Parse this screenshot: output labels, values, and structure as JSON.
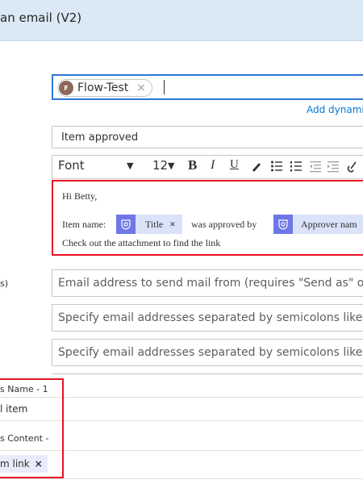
{
  "header": {
    "title": "an email (V2)"
  },
  "to": {
    "chip_label": "Flow-Test",
    "avatar_initial": "F",
    "chip_remove": "×",
    "add_dynamic": "Add dynami"
  },
  "subject": {
    "value": "Item approved"
  },
  "toolbar": {
    "font": "Font",
    "font_caret": "▼",
    "size": "12",
    "size_caret": "▼",
    "bold": "B",
    "italic": "I",
    "underline": "U"
  },
  "body": {
    "greeting": "Hi Betty,",
    "item_name_label": "Item name:",
    "title_token": "Title",
    "token_remove": "×",
    "approved_by": "was approved by",
    "approver_token": "Approver nam",
    "closing": "Check out the attachment to find the link"
  },
  "from": {
    "side_label": "s)",
    "placeholder": "Email address to send mail from (requires \"Send as\" or \"Se"
  },
  "cc": {
    "placeholder": "Specify email addresses separated by semicolons like some"
  },
  "bcc": {
    "placeholder": "Specify email addresses separated by semicolons like some"
  },
  "attachments": {
    "name_label": "s Name - 1",
    "name_value": "l item",
    "content_label": "s Content -",
    "content_token": "m link",
    "content_token_remove": "×"
  },
  "colors": {
    "accent": "#0078d4",
    "highlight": "#e81123",
    "token_icon": "#6d78e6"
  }
}
